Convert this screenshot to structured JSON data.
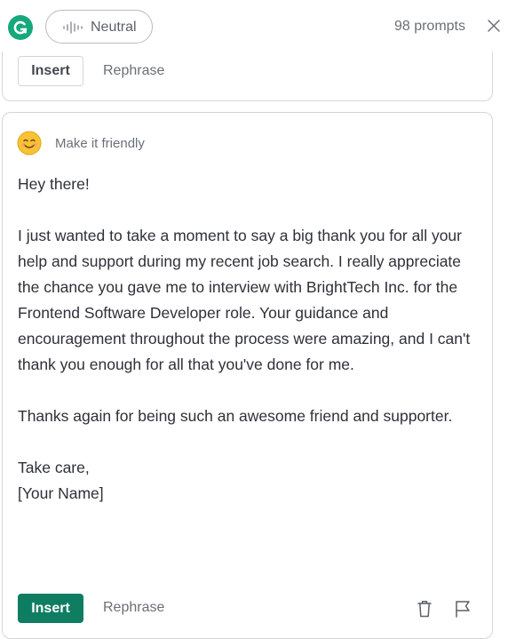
{
  "header": {
    "logo_icon": "grammarly-logo-icon",
    "tone_label": "Neutral",
    "prompts_count": "98 prompts",
    "close_icon": "close-icon"
  },
  "previous_suggestion": {
    "insert_label": "Insert",
    "rephrase_label": "Rephrase"
  },
  "suggestion": {
    "emoji_icon": "smiling-face-icon",
    "label": "Make it friendly",
    "greeting": "Hey there!",
    "body": "I just wanted to take a moment to say a big thank you for all your help and support during my recent job search. I really appreciate the chance you gave me to interview with BrightTech Inc. for the Frontend Software Developer role. Your guidance and encouragement throughout the process were amazing, and I can't thank you enough for all that you've done for me.",
    "thanks": "Thanks again for being such an awesome friend and supporter.",
    "signoff": "Take care,",
    "signature": "[Your Name]",
    "insert_label": "Insert",
    "rephrase_label": "Rephrase",
    "delete_icon": "trash-icon",
    "flag_icon": "flag-icon"
  },
  "colors": {
    "brand_green": "#15a87a",
    "insert_button": "#0e7d62",
    "border": "#d3d6db",
    "muted_text": "#6b7077"
  }
}
